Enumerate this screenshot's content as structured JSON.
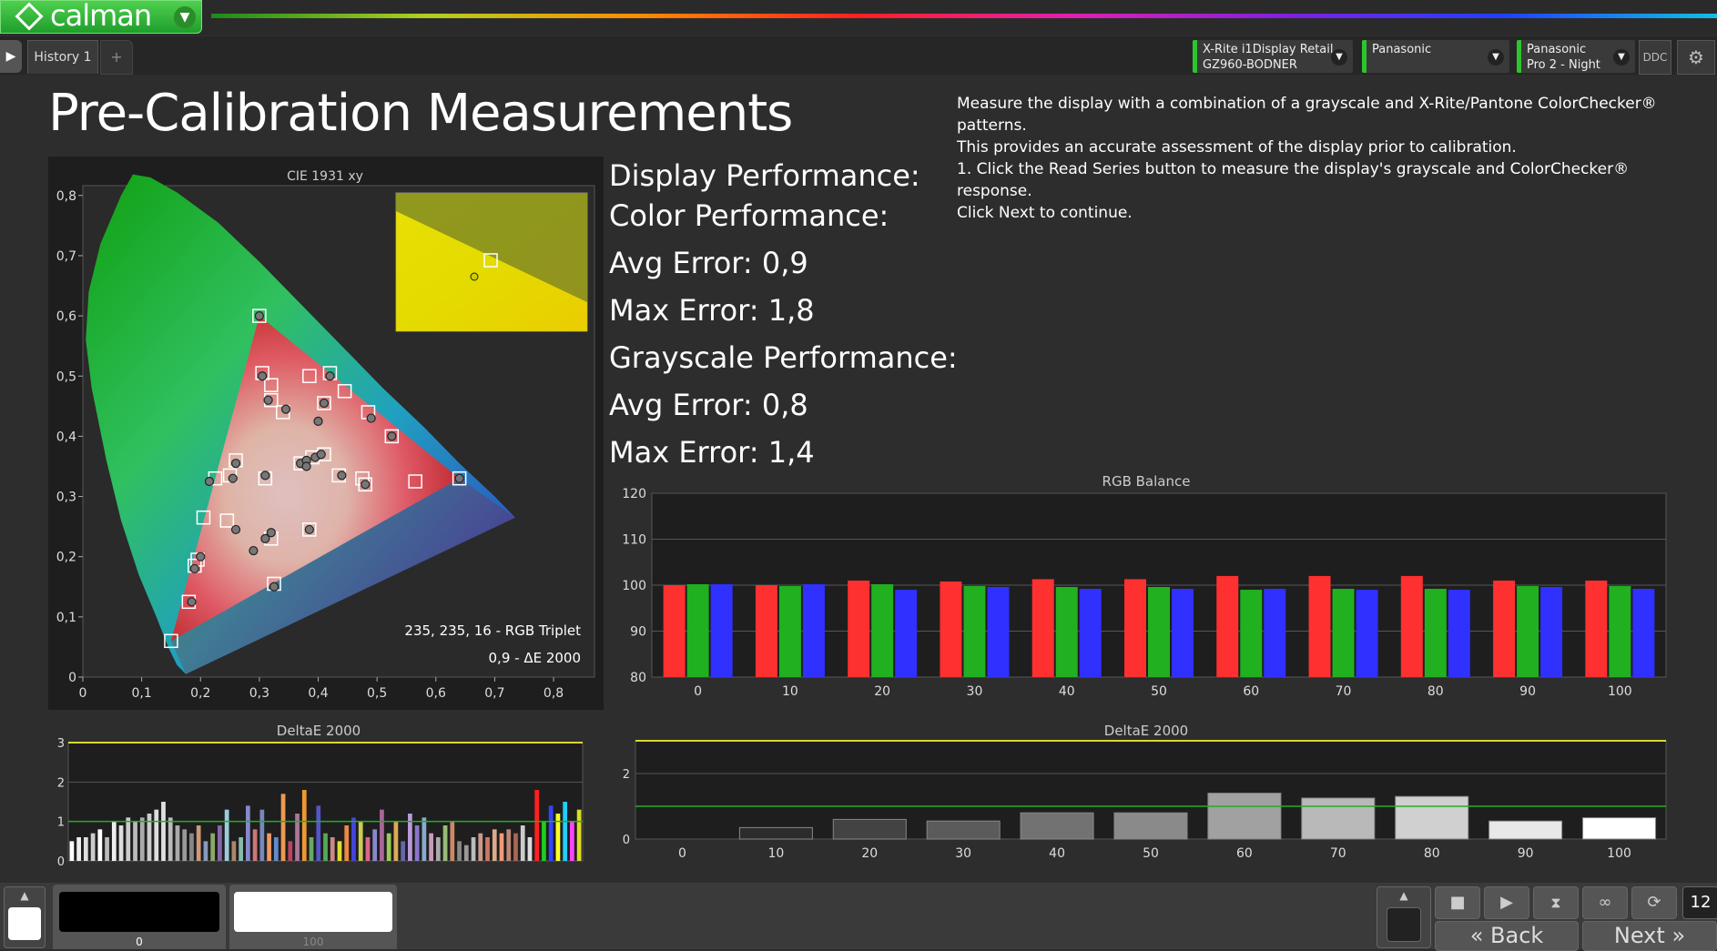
{
  "app": {
    "name": "calman"
  },
  "tabs": [
    {
      "label": "History 1"
    }
  ],
  "devices": [
    {
      "line1": "X-Rite i1Display Retail",
      "line2": "GZ960-BODNER"
    },
    {
      "line1": "Panasonic",
      "line2": ""
    },
    {
      "line1": "Panasonic",
      "line2": "Pro 2 - Night"
    }
  ],
  "ddc_label": "DDC",
  "page_title": "Pre-Calibration Measurements",
  "instructions": [
    "Measure the display with a combination of a grayscale and X-Rite/Pantone ColorChecker® patterns.",
    "This provides an accurate assessment of the display prior to calibration.",
    "1. Click the Read Series button to measure the display's grayscale and ColorChecker® response.",
    "Click Next to continue."
  ],
  "performance": {
    "display_label": "Display Performance:",
    "color_label": "Color Performance:",
    "color_avg": "Avg Error: 0,9",
    "color_max": "Max Error: 1,8",
    "gray_label": "Grayscale Performance:",
    "gray_avg": "Avg Error: 0,8",
    "gray_max": "Max Error: 1,4"
  },
  "cie": {
    "title": "CIE 1931 xy",
    "xticks": [
      "0",
      "0,1",
      "0,2",
      "0,3",
      "0,4",
      "0,5",
      "0,6",
      "0,7",
      "0,8"
    ],
    "yticks": [
      "0",
      "0,1",
      "0,2",
      "0,3",
      "0,4",
      "0,5",
      "0,6",
      "0,7",
      "0,8"
    ],
    "readout_triplet": "235, 235, 16 - RGB Triplet",
    "readout_de": "0,9 - ΔE 2000"
  },
  "chart_data": [
    {
      "type": "bar",
      "title": "RGB Balance",
      "categories": [
        "0",
        "10",
        "20",
        "30",
        "40",
        "50",
        "60",
        "70",
        "80",
        "90",
        "100"
      ],
      "ylim": [
        80,
        120
      ],
      "yticks": [
        "80",
        "90",
        "100",
        "110",
        "120"
      ],
      "series": [
        {
          "color": "#ff3030",
          "values": [
            100,
            100,
            101,
            100.8,
            101.3,
            101.3,
            102,
            102,
            102,
            101,
            101
          ]
        },
        {
          "color": "#20b020",
          "values": [
            100.2,
            99.8,
            100.2,
            99.8,
            99.6,
            99.6,
            99,
            99.2,
            99.2,
            99.8,
            99.8
          ]
        },
        {
          "color": "#3030ff",
          "values": [
            100.2,
            100.2,
            99,
            99.6,
            99.2,
            99.2,
            99.2,
            99,
            99,
            99.6,
            99.2
          ]
        }
      ]
    },
    {
      "type": "bar",
      "title": "DeltaE 2000",
      "ylim": [
        0,
        3
      ],
      "yticks": [
        "0",
        "1",
        "2",
        "3"
      ],
      "threshold": 1,
      "values": [
        0.5,
        0.6,
        0.6,
        0.7,
        0.8,
        0.6,
        1.0,
        0.9,
        1.1,
        1.0,
        1.1,
        1.2,
        1.3,
        1.5,
        1.1,
        0.9,
        0.8,
        0.7,
        0.9,
        0.5,
        0.7,
        0.9,
        1.3,
        0.5,
        0.6,
        1.4,
        0.8,
        1.3,
        0.7,
        0.6,
        1.7,
        0.5,
        1.2,
        1.8,
        0.6,
        1.4,
        0.7,
        0.6,
        0.5,
        0.9,
        1.1,
        1.0,
        0.6,
        0.8,
        1.3,
        0.7,
        1.0,
        0.5,
        1.2,
        0.9,
        1.1,
        0.7,
        0.6,
        0.9,
        1.0,
        0.5,
        0.4,
        0.6,
        0.7,
        0.6,
        0.8,
        0.7,
        0.8,
        0.7,
        0.9,
        0.6,
        1.8,
        1.0,
        1.4,
        1.2,
        1.5,
        1.0,
        1.3
      ],
      "colors": [
        "#ffffff",
        "#eeeeee",
        "#dddddd",
        "#cccccc",
        "#ffffff",
        "#bbbbbb",
        "#eeeeee",
        "#dddddd",
        "#cccccc",
        "#bbbbbb",
        "#aaaaaa",
        "#cccccc",
        "#dddddd",
        "#e0e0e0",
        "#bbbbbb",
        "#aaaaaa",
        "#999999",
        "#888888",
        "#cc9977",
        "#8899bb",
        "#88aa66",
        "#8866aa",
        "#99ccdd",
        "#aa8866",
        "#88bbaa",
        "#8888cc",
        "#cc7777",
        "#7788bb",
        "#ee9966",
        "#6688cc",
        "#ee9955",
        "#bb4466",
        "#aa7799",
        "#ee9933",
        "#66aa66",
        "#5555cc",
        "#55aa55",
        "#cc8888",
        "#dddd33",
        "#ee8844",
        "#4444dd",
        "#cccc55",
        "#dd6688",
        "#8888cc",
        "#aa6699",
        "#99cc55",
        "#ddaa55",
        "#6666aa",
        "#bb99dd",
        "#8877cc",
        "#88aacc",
        "#cc99bb",
        "#aaaaaa",
        "#99bb77",
        "#cc8866",
        "#888888",
        "#999999",
        "#bbbbbb",
        "#cc9988",
        "#cc7766",
        "#ddaa88",
        "#ee9977",
        "#bb8877",
        "#aa6655",
        "#cccccc",
        "#dddddd",
        "#ff2020",
        "#20cc20",
        "#3344ff",
        "#ffff22",
        "#22ccff",
        "#ff44ff",
        "#dddd22"
      ]
    },
    {
      "type": "bar",
      "title": "DeltaE 2000",
      "categories": [
        "0",
        "10",
        "20",
        "30",
        "40",
        "50",
        "60",
        "70",
        "80",
        "90",
        "100"
      ],
      "ylim": [
        0,
        3
      ],
      "yticks": [
        "0",
        "2"
      ],
      "threshold": 1,
      "values": [
        0.0,
        0.35,
        0.6,
        0.55,
        0.8,
        0.8,
        1.4,
        1.25,
        1.3,
        0.55,
        0.65
      ]
    },
    {
      "type": "scatter",
      "title": "CIE 1931 xy",
      "xlim": [
        0,
        0.8
      ],
      "ylim": [
        0,
        0.8
      ],
      "targets": [
        [
          0.15,
          0.06
        ],
        [
          0.18,
          0.125
        ],
        [
          0.195,
          0.195
        ],
        [
          0.19,
          0.185
        ],
        [
          0.205,
          0.265
        ],
        [
          0.245,
          0.26
        ],
        [
          0.225,
          0.33
        ],
        [
          0.25,
          0.335
        ],
        [
          0.26,
          0.36
        ],
        [
          0.31,
          0.33
        ],
        [
          0.32,
          0.23
        ],
        [
          0.325,
          0.155
        ],
        [
          0.3,
          0.6
        ],
        [
          0.305,
          0.505
        ],
        [
          0.32,
          0.485
        ],
        [
          0.32,
          0.46
        ],
        [
          0.34,
          0.44
        ],
        [
          0.385,
          0.5
        ],
        [
          0.42,
          0.505
        ],
        [
          0.41,
          0.455
        ],
        [
          0.445,
          0.475
        ],
        [
          0.485,
          0.44
        ],
        [
          0.525,
          0.4
        ],
        [
          0.385,
          0.245
        ],
        [
          0.435,
          0.335
        ],
        [
          0.475,
          0.33
        ],
        [
          0.48,
          0.32
        ],
        [
          0.565,
          0.325
        ],
        [
          0.64,
          0.33
        ],
        [
          0.37,
          0.355
        ],
        [
          0.39,
          0.365
        ],
        [
          0.41,
          0.37
        ]
      ],
      "measured": [
        [
          0.185,
          0.125
        ],
        [
          0.19,
          0.18
        ],
        [
          0.2,
          0.2
        ],
        [
          0.215,
          0.325
        ],
        [
          0.255,
          0.33
        ],
        [
          0.26,
          0.355
        ],
        [
          0.26,
          0.245
        ],
        [
          0.29,
          0.21
        ],
        [
          0.31,
          0.23
        ],
        [
          0.3,
          0.6
        ],
        [
          0.305,
          0.5
        ],
        [
          0.315,
          0.46
        ],
        [
          0.345,
          0.445
        ],
        [
          0.4,
          0.425
        ],
        [
          0.41,
          0.455
        ],
        [
          0.42,
          0.5
        ],
        [
          0.325,
          0.15
        ],
        [
          0.37,
          0.355
        ],
        [
          0.38,
          0.36
        ],
        [
          0.395,
          0.365
        ],
        [
          0.405,
          0.37
        ],
        [
          0.44,
          0.335
        ],
        [
          0.48,
          0.32
        ],
        [
          0.49,
          0.43
        ],
        [
          0.525,
          0.4
        ],
        [
          0.64,
          0.33
        ],
        [
          0.31,
          0.335
        ],
        [
          0.385,
          0.245
        ],
        [
          0.32,
          0.24
        ],
        [
          0.38,
          0.35
        ]
      ]
    }
  ],
  "bottom": {
    "swatch_left_label": "0",
    "swatch_right_label": "100",
    "back_label": "Back",
    "next_label": "Next",
    "counter": "12"
  }
}
